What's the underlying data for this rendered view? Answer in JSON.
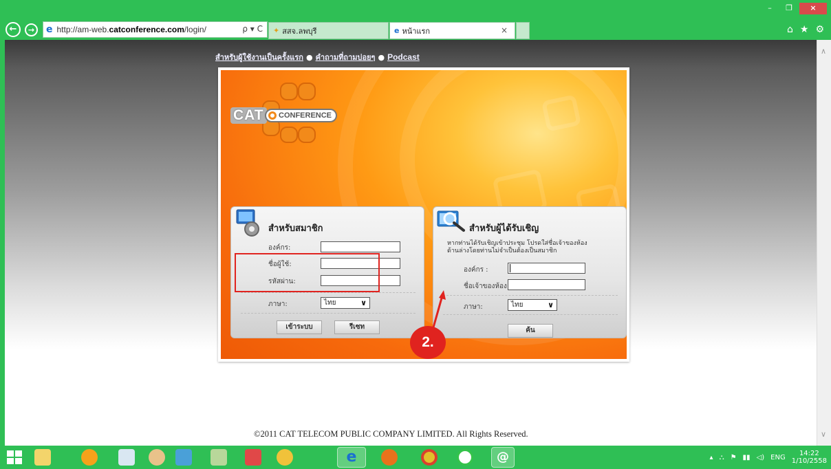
{
  "window": {
    "controls": {
      "minimize": "–",
      "restore": "❐",
      "close": "×"
    }
  },
  "browser": {
    "address_prefix": "http://am-web.",
    "address_domain": "catconference.com",
    "address_suffix": "/login/",
    "address_controls": "ρ ▾ C",
    "tabs": [
      {
        "label": "สสจ.ลพบุรี",
        "active": false
      },
      {
        "label": "หน้าแรก",
        "active": true
      }
    ],
    "toolbar_icons": [
      "home-icon",
      "favorites-icon",
      "settings-icon"
    ]
  },
  "page": {
    "top_links": [
      {
        "label": "สำหรับผู้ใช้งานเป็นครั้งแรก"
      },
      {
        "label": "คำถามที่ถามบ่อยๆ"
      },
      {
        "label": "Podcast"
      }
    ],
    "logo": {
      "cat": "CAT",
      "conference": "CONFERENCE"
    },
    "member_panel": {
      "title": "สำหรับสมาชิก",
      "org_label": "องค์กร:",
      "user_label": "ชื่อผู้ใช้:",
      "password_label": "รหัสผ่าน:",
      "language_label": "ภาษา:",
      "language_value": "ไทย",
      "login_button": "เข้าระบบ",
      "reset_button": "รีเซท"
    },
    "guest_panel": {
      "title": "สำหรับผู้ได้รับเชิญ",
      "description_line1": "หากท่านได้รับเชิญเข้าประชุม โปรดใส่ชื่อเจ้าของห้อง",
      "description_line2": "ด้านล่างโดยท่านไม่จำเป็นต้องเป็นสมาชิก",
      "org_label": "องค์กร :",
      "owner_label": "ชื่อเจ้าของห้อง :",
      "language_label": "ภาษา:",
      "language_value": "ไทย",
      "search_button": "ค้น"
    },
    "copyright": "©2011 CAT TELECOM PUBLIC COMPANY LIMITED. All Rights Reserved."
  },
  "annotation": {
    "badge": "2."
  },
  "colors": {
    "chrome": "#2fbf55",
    "highlight": "#e0231f",
    "card_orange": "#f76a0c"
  },
  "taskbar": {
    "apps": [
      "start-icon",
      "file-explorer-icon",
      "app-a-icon",
      "calculator-icon",
      "paint-icon",
      "notebook-icon",
      "edit-icon",
      "eraser-icon",
      "paint-palette-icon",
      "internet-explorer-icon",
      "firefox-icon",
      "chrome-icon",
      "line-icon",
      "email-icon"
    ],
    "tray": {
      "language": "ENG",
      "time": "14:22",
      "date": "1/10/2558"
    }
  }
}
